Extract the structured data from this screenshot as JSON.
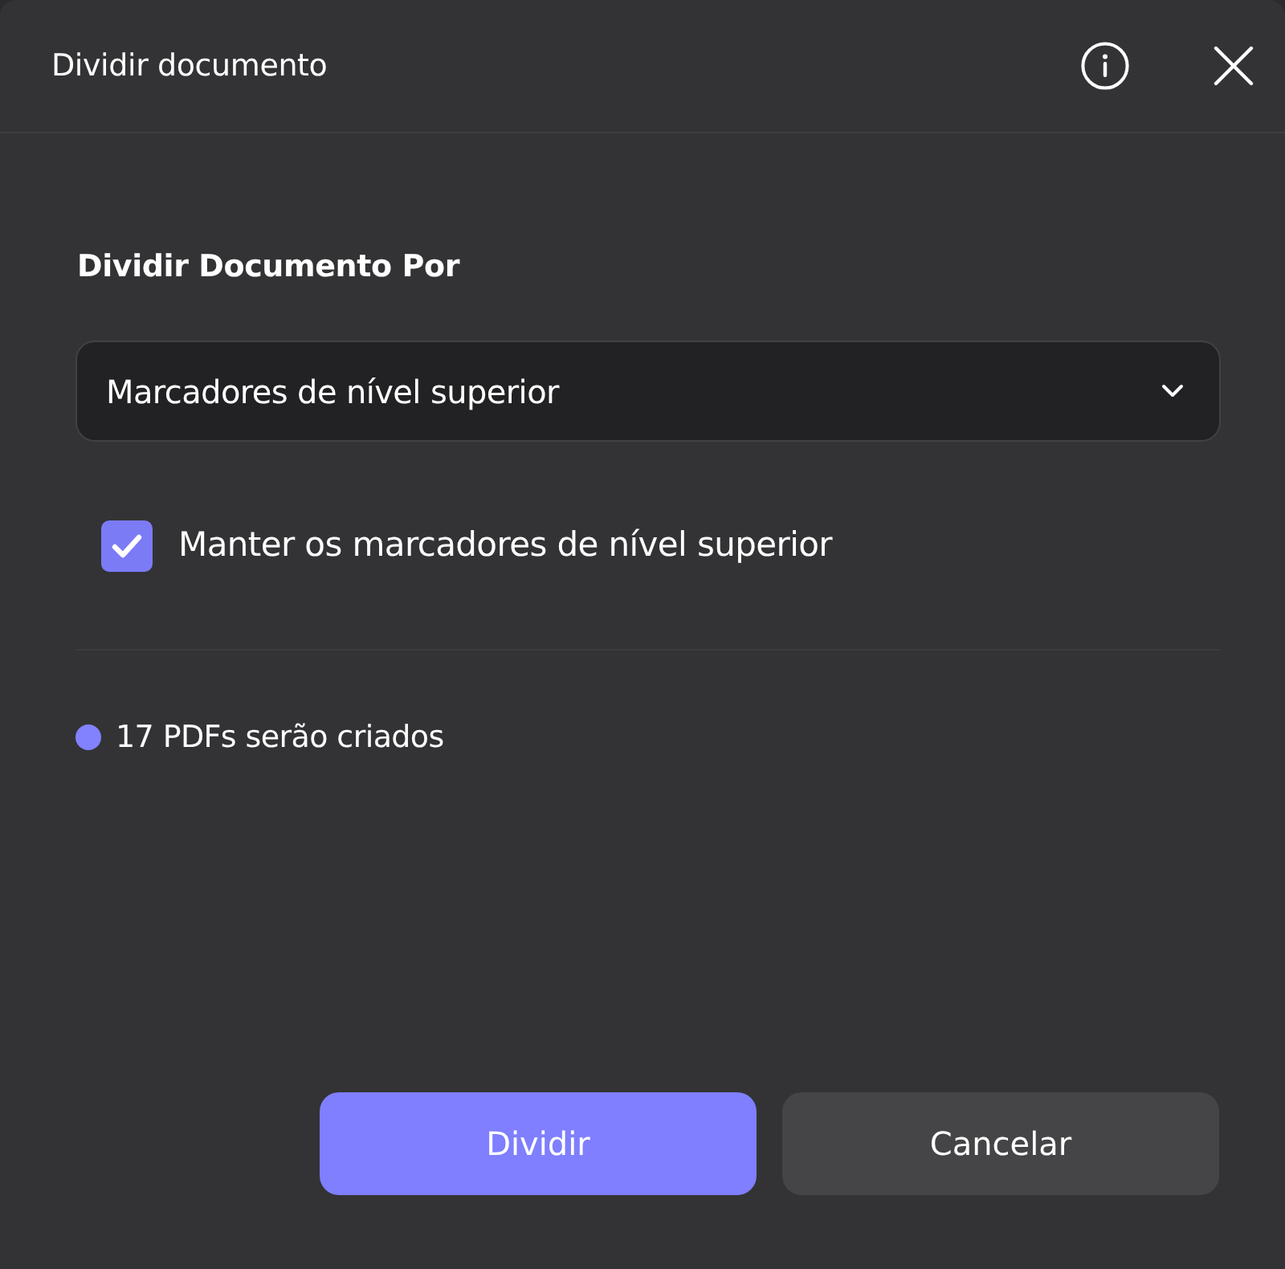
{
  "dialog": {
    "title": "Dividir documento"
  },
  "split_by": {
    "label": "Dividir Documento Por",
    "dropdown": {
      "value": "Marcadores de nível superior"
    }
  },
  "option": {
    "label": "Manter os marcadores de nível superior",
    "checked": true
  },
  "summary": {
    "text": "17 PDFs serão criados"
  },
  "buttons": [
    {
      "label": "Dividir",
      "kind": "primary"
    },
    {
      "label": "Cancelar",
      "kind": "secondary"
    }
  ]
}
